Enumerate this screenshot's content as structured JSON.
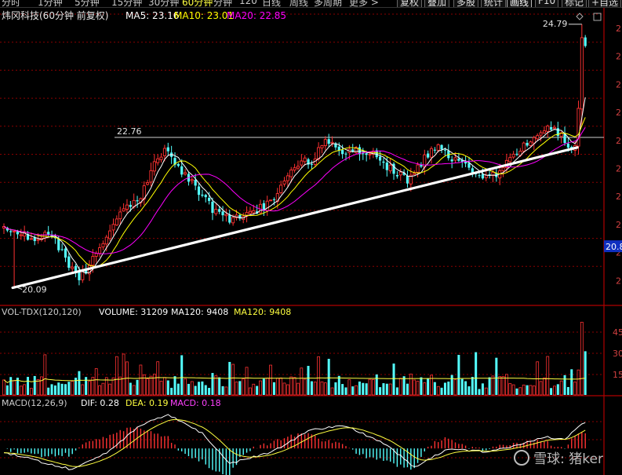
{
  "toolbar": {
    "periods": [
      "分时",
      "1分钟",
      "5分钟",
      "15分钟",
      "30分钟",
      "60分钟",
      "分钟",
      "120",
      "日线",
      "周线",
      "多周期",
      "更多 >"
    ],
    "active_period": "60分钟",
    "buttons": [
      "复权",
      "叠加",
      "多股",
      "统计",
      "画线",
      "F10",
      "标记",
      "+自选"
    ],
    "active_button": "画线"
  },
  "header": {
    "title": "炜冈科技(60分钟 前复权)",
    "ma5": "MA5: 23.16",
    "ma10": "MA10: 23.01",
    "ma20": "MA20: 22.85"
  },
  "volume_header": {
    "label": "VOL-TDX(120,120)",
    "volume": "VOLUME: 31209",
    "ma120_a": "MA120: 9408",
    "ma120_b": "MA120: 9408"
  },
  "macd_header": {
    "label": "MACD(12,26,9)",
    "dif": "DIF: 0.28",
    "dea": "DEA: 0.19",
    "macd": "MACD: 0.18"
  },
  "watermark": "雪球: 猪ker",
  "colors": {
    "up": "#ff3232",
    "down": "#54ffff",
    "ma5": "#ffffff",
    "ma10": "#ffff00",
    "ma20": "#ff00ff",
    "grid": "#8b0000",
    "trendline": "#ffffff"
  },
  "chart_data": {
    "type": "candlestick",
    "price_axis": {
      "min": 19.9,
      "max": 25.0,
      "current_label": "20.8",
      "tick_labels": [
        "2",
        "2",
        "2",
        "2",
        "2",
        "2",
        "2",
        "2",
        "2",
        "2"
      ]
    },
    "annotations": {
      "high": "24.79",
      "low": "20.09",
      "hline": "22.76",
      "hline_value": 22.76
    },
    "volume_axis": {
      "ticks": [
        "45",
        "30",
        "15"
      ],
      "max": 55000
    },
    "macd_axis": {
      "min": -0.35,
      "max": 0.55
    },
    "trendline": {
      "from": {
        "bar": 3,
        "price": 20.09
      },
      "to": {
        "bar": 167,
        "price": 22.58
      }
    },
    "anchors": [
      [
        0,
        21.15
      ],
      [
        8,
        20.95
      ],
      [
        14,
        21.05
      ],
      [
        18,
        20.55
      ],
      [
        22,
        20.2
      ],
      [
        26,
        20.55
      ],
      [
        32,
        21.2
      ],
      [
        36,
        21.5
      ],
      [
        40,
        21.7
      ],
      [
        44,
        22.3
      ],
      [
        48,
        22.55
      ],
      [
        51,
        22.2
      ],
      [
        55,
        21.95
      ],
      [
        58,
        21.7
      ],
      [
        62,
        21.4
      ],
      [
        66,
        21.3
      ],
      [
        72,
        21.4
      ],
      [
        78,
        21.6
      ],
      [
        82,
        21.95
      ],
      [
        86,
        22.3
      ],
      [
        90,
        22.35
      ],
      [
        94,
        22.7
      ],
      [
        98,
        22.5
      ],
      [
        102,
        22.55
      ],
      [
        108,
        22.45
      ],
      [
        112,
        22.25
      ],
      [
        116,
        22.1
      ],
      [
        118,
        22.0
      ],
      [
        122,
        22.3
      ],
      [
        126,
        22.6
      ],
      [
        130,
        22.45
      ],
      [
        134,
        22.25
      ],
      [
        138,
        22.15
      ],
      [
        142,
        22.05
      ],
      [
        146,
        22.2
      ],
      [
        150,
        22.5
      ],
      [
        154,
        22.7
      ],
      [
        158,
        22.95
      ],
      [
        162,
        22.85
      ],
      [
        165,
        22.6
      ],
      [
        167,
        22.65
      ],
      [
        170,
        24.5
      ]
    ],
    "macd_anchors": [
      [
        0,
        -0.05
      ],
      [
        20,
        -0.28
      ],
      [
        30,
        -0.05
      ],
      [
        40,
        0.3
      ],
      [
        48,
        0.45
      ],
      [
        58,
        0.2
      ],
      [
        66,
        -0.2
      ],
      [
        78,
        -0.05
      ],
      [
        90,
        0.25
      ],
      [
        100,
        0.3
      ],
      [
        112,
        0.05
      ],
      [
        120,
        -0.25
      ],
      [
        130,
        0.0
      ],
      [
        142,
        -0.05
      ],
      [
        150,
        0.05
      ],
      [
        158,
        0.15
      ],
      [
        164,
        0.12
      ],
      [
        170,
        0.35
      ]
    ]
  }
}
